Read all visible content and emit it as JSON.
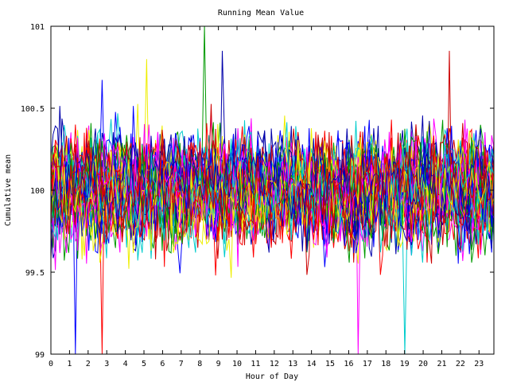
{
  "chart_data": {
    "type": "line",
    "title": "Running Mean Value",
    "xlabel": "Hour of Day",
    "ylabel": "Cumulative mean",
    "xlim": [
      0,
      23.8
    ],
    "ylim": [
      99,
      101
    ],
    "x_ticks": [
      "0",
      "1",
      "2",
      "3",
      "4",
      "5",
      "6",
      "7",
      "8",
      "9",
      "10",
      "11",
      "12",
      "13",
      "14",
      "15",
      "16",
      "17",
      "18",
      "19",
      "20",
      "21",
      "22",
      "23"
    ],
    "y_ticks": [
      "99",
      "99.5",
      "100",
      "100.5",
      "101"
    ],
    "grid": false,
    "legend": "none",
    "series_count": 48,
    "points_per_series": 200,
    "center_value": 100,
    "typical_spread": 0.22,
    "palette": [
      "#0000ff",
      "#ff0000",
      "#009900",
      "#ff00ff",
      "#00cccc",
      "#eeee00",
      "#0000aa",
      "#cc0000"
    ],
    "notable_extremes": [
      {
        "x": 1.3,
        "y": 99.0
      },
      {
        "x": 2.7,
        "y": 99.0
      },
      {
        "x": 8.3,
        "y": 101.0
      },
      {
        "x": 16.5,
        "y": 99.0
      },
      {
        "x": 19.0,
        "y": 99.0
      },
      {
        "x": 5.2,
        "y": 100.8
      },
      {
        "x": 9.2,
        "y": 100.85
      },
      {
        "x": 21.4,
        "y": 100.85
      }
    ]
  }
}
